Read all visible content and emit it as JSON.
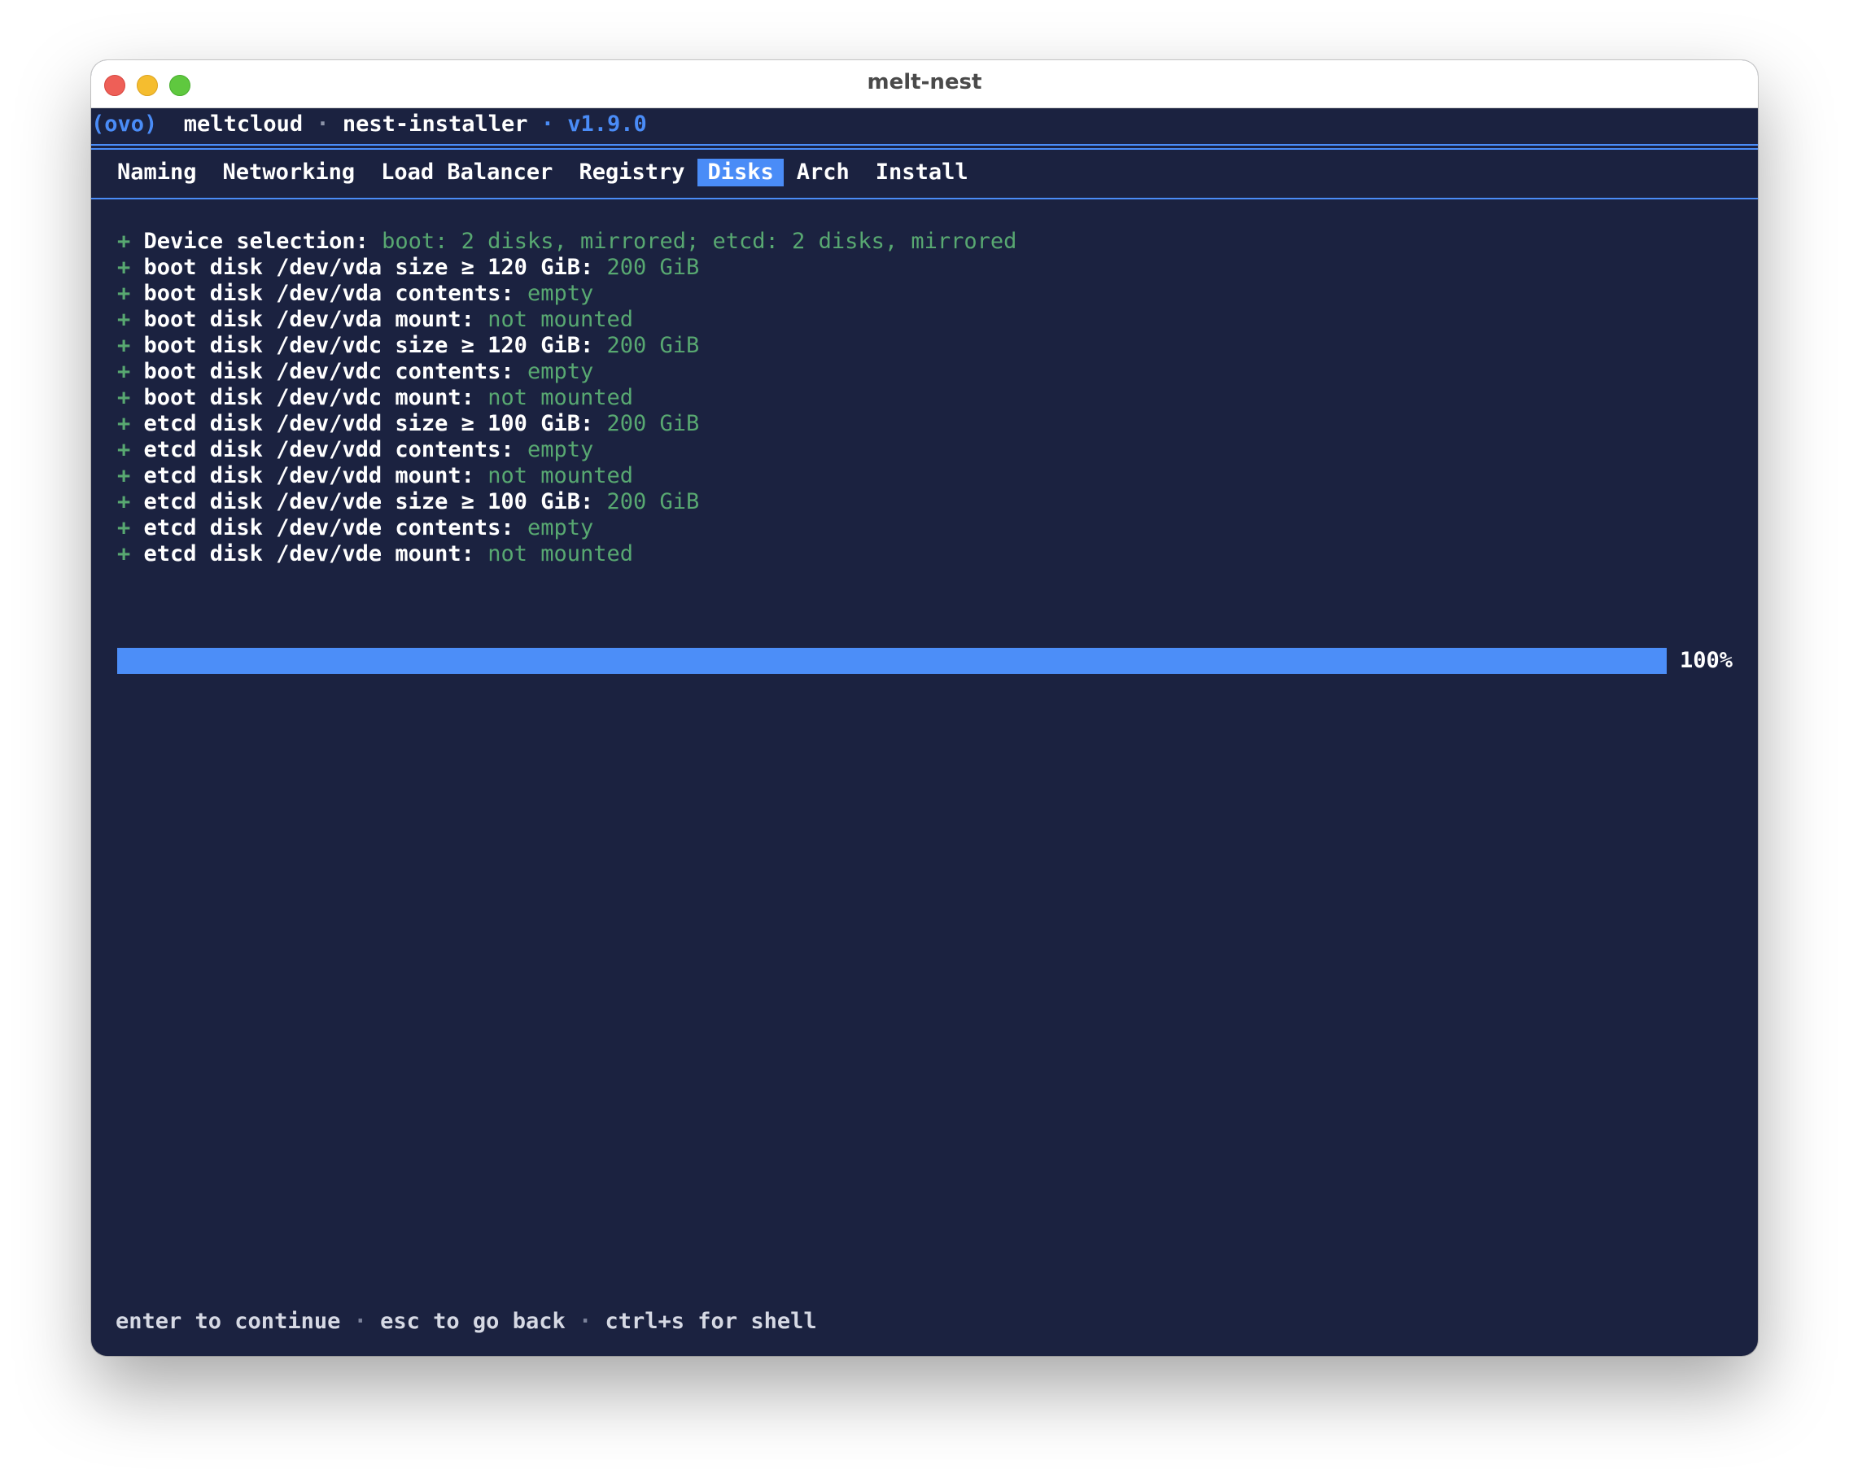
{
  "window": {
    "title": "melt-nest"
  },
  "header": {
    "logo": "(ovo)",
    "brand": "meltcloud",
    "separator": "·",
    "app_name": "nest-installer",
    "version": "v1.9.0"
  },
  "tabs": [
    {
      "label": "Naming",
      "active": false
    },
    {
      "label": "Networking",
      "active": false
    },
    {
      "label": "Load Balancer",
      "active": false
    },
    {
      "label": "Registry",
      "active": false
    },
    {
      "label": "Disks",
      "active": true
    },
    {
      "label": "Arch",
      "active": false
    },
    {
      "label": "Install",
      "active": false
    }
  ],
  "checks": [
    {
      "marker": "+",
      "label": "Device selection:",
      "value": "boot: 2 disks, mirrored; etcd: 2 disks, mirrored"
    },
    {
      "marker": "+",
      "label": "boot disk /dev/vda size ≥ 120 GiB:",
      "value": "200 GiB"
    },
    {
      "marker": "+",
      "label": "boot disk /dev/vda contents:",
      "value": "empty"
    },
    {
      "marker": "+",
      "label": "boot disk /dev/vda mount:",
      "value": "not mounted"
    },
    {
      "marker": "+",
      "label": "boot disk /dev/vdc size ≥ 120 GiB:",
      "value": "200 GiB"
    },
    {
      "marker": "+",
      "label": "boot disk /dev/vdc contents:",
      "value": "empty"
    },
    {
      "marker": "+",
      "label": "boot disk /dev/vdc mount:",
      "value": "not mounted"
    },
    {
      "marker": "+",
      "label": "etcd disk /dev/vdd size ≥ 100 GiB:",
      "value": "200 GiB"
    },
    {
      "marker": "+",
      "label": "etcd disk /dev/vdd contents:",
      "value": "empty"
    },
    {
      "marker": "+",
      "label": "etcd disk /dev/vdd mount:",
      "value": "not mounted"
    },
    {
      "marker": "+",
      "label": "etcd disk /dev/vde size ≥ 100 GiB:",
      "value": "200 GiB"
    },
    {
      "marker": "+",
      "label": "etcd disk /dev/vde contents:",
      "value": "empty"
    },
    {
      "marker": "+",
      "label": "etcd disk /dev/vde mount:",
      "value": "not mounted"
    }
  ],
  "progress": {
    "percent": 100,
    "label": "100%"
  },
  "footer": {
    "enter": "enter to continue",
    "esc": "esc to go back",
    "shell": "ctrl+s for shell",
    "separator": "·"
  },
  "colors": {
    "background": "#1b2240",
    "accent": "#4a8cf7",
    "ok": "#58a871"
  }
}
